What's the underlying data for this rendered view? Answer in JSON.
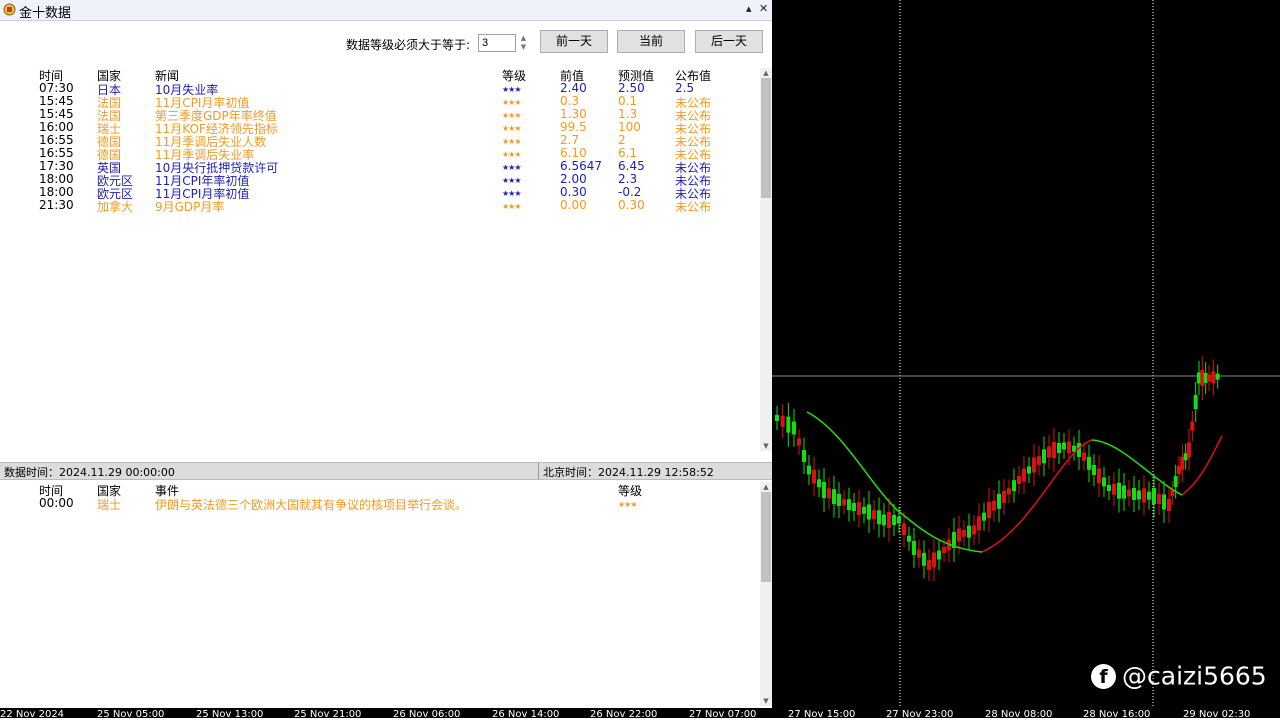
{
  "window": {
    "title": "金十数据",
    "pin_icon": "▴",
    "close_icon": "✕"
  },
  "filter": {
    "label": "数据等级必须大于等于:",
    "value": "3",
    "prev_day": "前一天",
    "current": "当前",
    "next_day": "后一天"
  },
  "colors": {
    "blue": "#1f1fb0",
    "orange": "#f29a1f",
    "up_candle": "#e01010",
    "down_candle": "#10e010"
  },
  "calendar": {
    "headers": [
      "时间",
      "国家",
      "新闻",
      "等级",
      "前值",
      "预测值",
      "公布值"
    ],
    "rows": [
      {
        "time": "07:30",
        "country": "日本",
        "news": "10月失业率",
        "stars": "★★★",
        "prev": "2.40",
        "forecast": "2.50",
        "actual": "2.5",
        "color": "blue"
      },
      {
        "time": "15:45",
        "country": "法国",
        "news": "11月CPI月率初值",
        "stars": "★★★",
        "prev": "0.3",
        "forecast": "0.1",
        "actual": "未公布",
        "color": "orange"
      },
      {
        "time": "15:45",
        "country": "法国",
        "news": "第三季度GDP年率终值",
        "stars": "★★★",
        "prev": "1.30",
        "forecast": "1.3",
        "actual": "未公布",
        "color": "orange"
      },
      {
        "time": "16:00",
        "country": "瑞士",
        "news": "11月KOF经济领先指标",
        "stars": "★★★",
        "prev": "99.5",
        "forecast": "100",
        "actual": "未公布",
        "color": "orange"
      },
      {
        "time": "16:55",
        "country": "德国",
        "news": "11月季调后失业人数",
        "stars": "★★★",
        "prev": "2.7",
        "forecast": "2",
        "actual": "未公布",
        "color": "orange"
      },
      {
        "time": "16:55",
        "country": "德国",
        "news": "11月季调后失业率",
        "stars": "★★★",
        "prev": "6.10",
        "forecast": "6.1",
        "actual": "未公布",
        "color": "orange"
      },
      {
        "time": "17:30",
        "country": "英国",
        "news": "10月央行抵押贷款许可",
        "stars": "★★★",
        "prev": "6.5647",
        "forecast": "6.45",
        "actual": "未公布",
        "color": "blue"
      },
      {
        "time": "18:00",
        "country": "欧元区",
        "news": "11月CPI年率初值",
        "stars": "★★★",
        "prev": "2.00",
        "forecast": "2.3",
        "actual": "未公布",
        "color": "blue"
      },
      {
        "time": "18:00",
        "country": "欧元区",
        "news": "11月CPI月率初值",
        "stars": "★★★",
        "prev": "0.30",
        "forecast": "-0.2",
        "actual": "未公布",
        "color": "blue"
      },
      {
        "time": "21:30",
        "country": "加拿大",
        "news": "9月GDP月率",
        "stars": "★★★",
        "prev": "0.00",
        "forecast": "0.30",
        "actual": "未公布",
        "color": "orange"
      }
    ]
  },
  "status": {
    "data_time": "数据时间：2024.11.29 00:00:00",
    "beijing_time": "北京时间：2024.11.29 12:58:52"
  },
  "events": {
    "headers": [
      "时间",
      "国家",
      "事件",
      "等级"
    ],
    "rows": [
      {
        "time": "00:00",
        "country": "瑞士",
        "event": "伊朗与英法德三个欧洲大国就其有争议的核项目举行会谈。",
        "stars": "★★★",
        "color": "orange"
      }
    ]
  },
  "xaxis": {
    "labels": [
      "22 Nov 2024",
      "25 Nov 05:00",
      "25 Nov 13:00",
      "25 Nov 21:00",
      "26 Nov 06:00",
      "26 Nov 14:00",
      "26 Nov 22:00",
      "27 Nov 07:00",
      "27 Nov 15:00",
      "27 Nov 23:00",
      "28 Nov 08:00",
      "28 Nov 16:00",
      "29 Nov 02:30"
    ]
  },
  "watermark": {
    "text": "@caizi5665",
    "icon": "facebook-icon"
  }
}
